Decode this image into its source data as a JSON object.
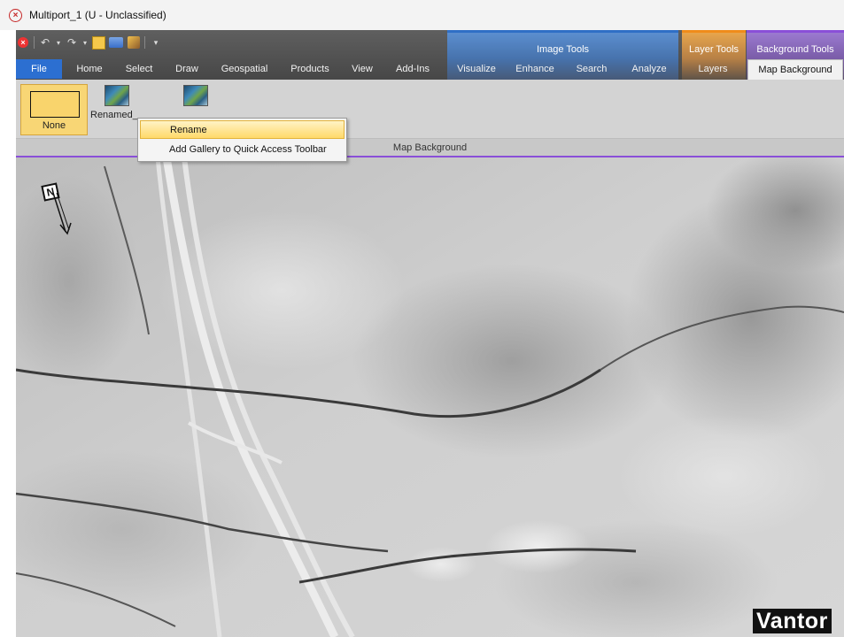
{
  "window": {
    "title": "Multiport_1 (U - Unclassified)"
  },
  "tabs": {
    "file": "File",
    "home": "Home",
    "select": "Select",
    "draw": "Draw",
    "geospatial": "Geospatial",
    "products": "Products",
    "view": "View",
    "addins": "Add-Ins",
    "visualize": "Visualize",
    "enhance": "Enhance",
    "search": "Search",
    "analyze": "Analyze",
    "layers": "Layers",
    "map_background": "Map Background"
  },
  "context_groups": {
    "image_tools": "Image Tools",
    "layer_tools": "Layer Tools",
    "background_tools": "Background Tools"
  },
  "ribbon": {
    "gallery": {
      "none_label": "None",
      "renamed_label": "Renamed_"
    },
    "group_caption": "Map Background"
  },
  "context_menu": {
    "rename": "Rename",
    "add_gallery": "Add Gallery to Quick Access Toolbar"
  },
  "map": {
    "north_label": "N",
    "watermark": "Vantor"
  },
  "colors": {
    "file_tab": "#2c6fd1",
    "image_tools": "#4a78b3",
    "layer_tools": "#d08a3c",
    "background_tools": "#8a66bf",
    "menu_highlight": "#ffd96a"
  }
}
